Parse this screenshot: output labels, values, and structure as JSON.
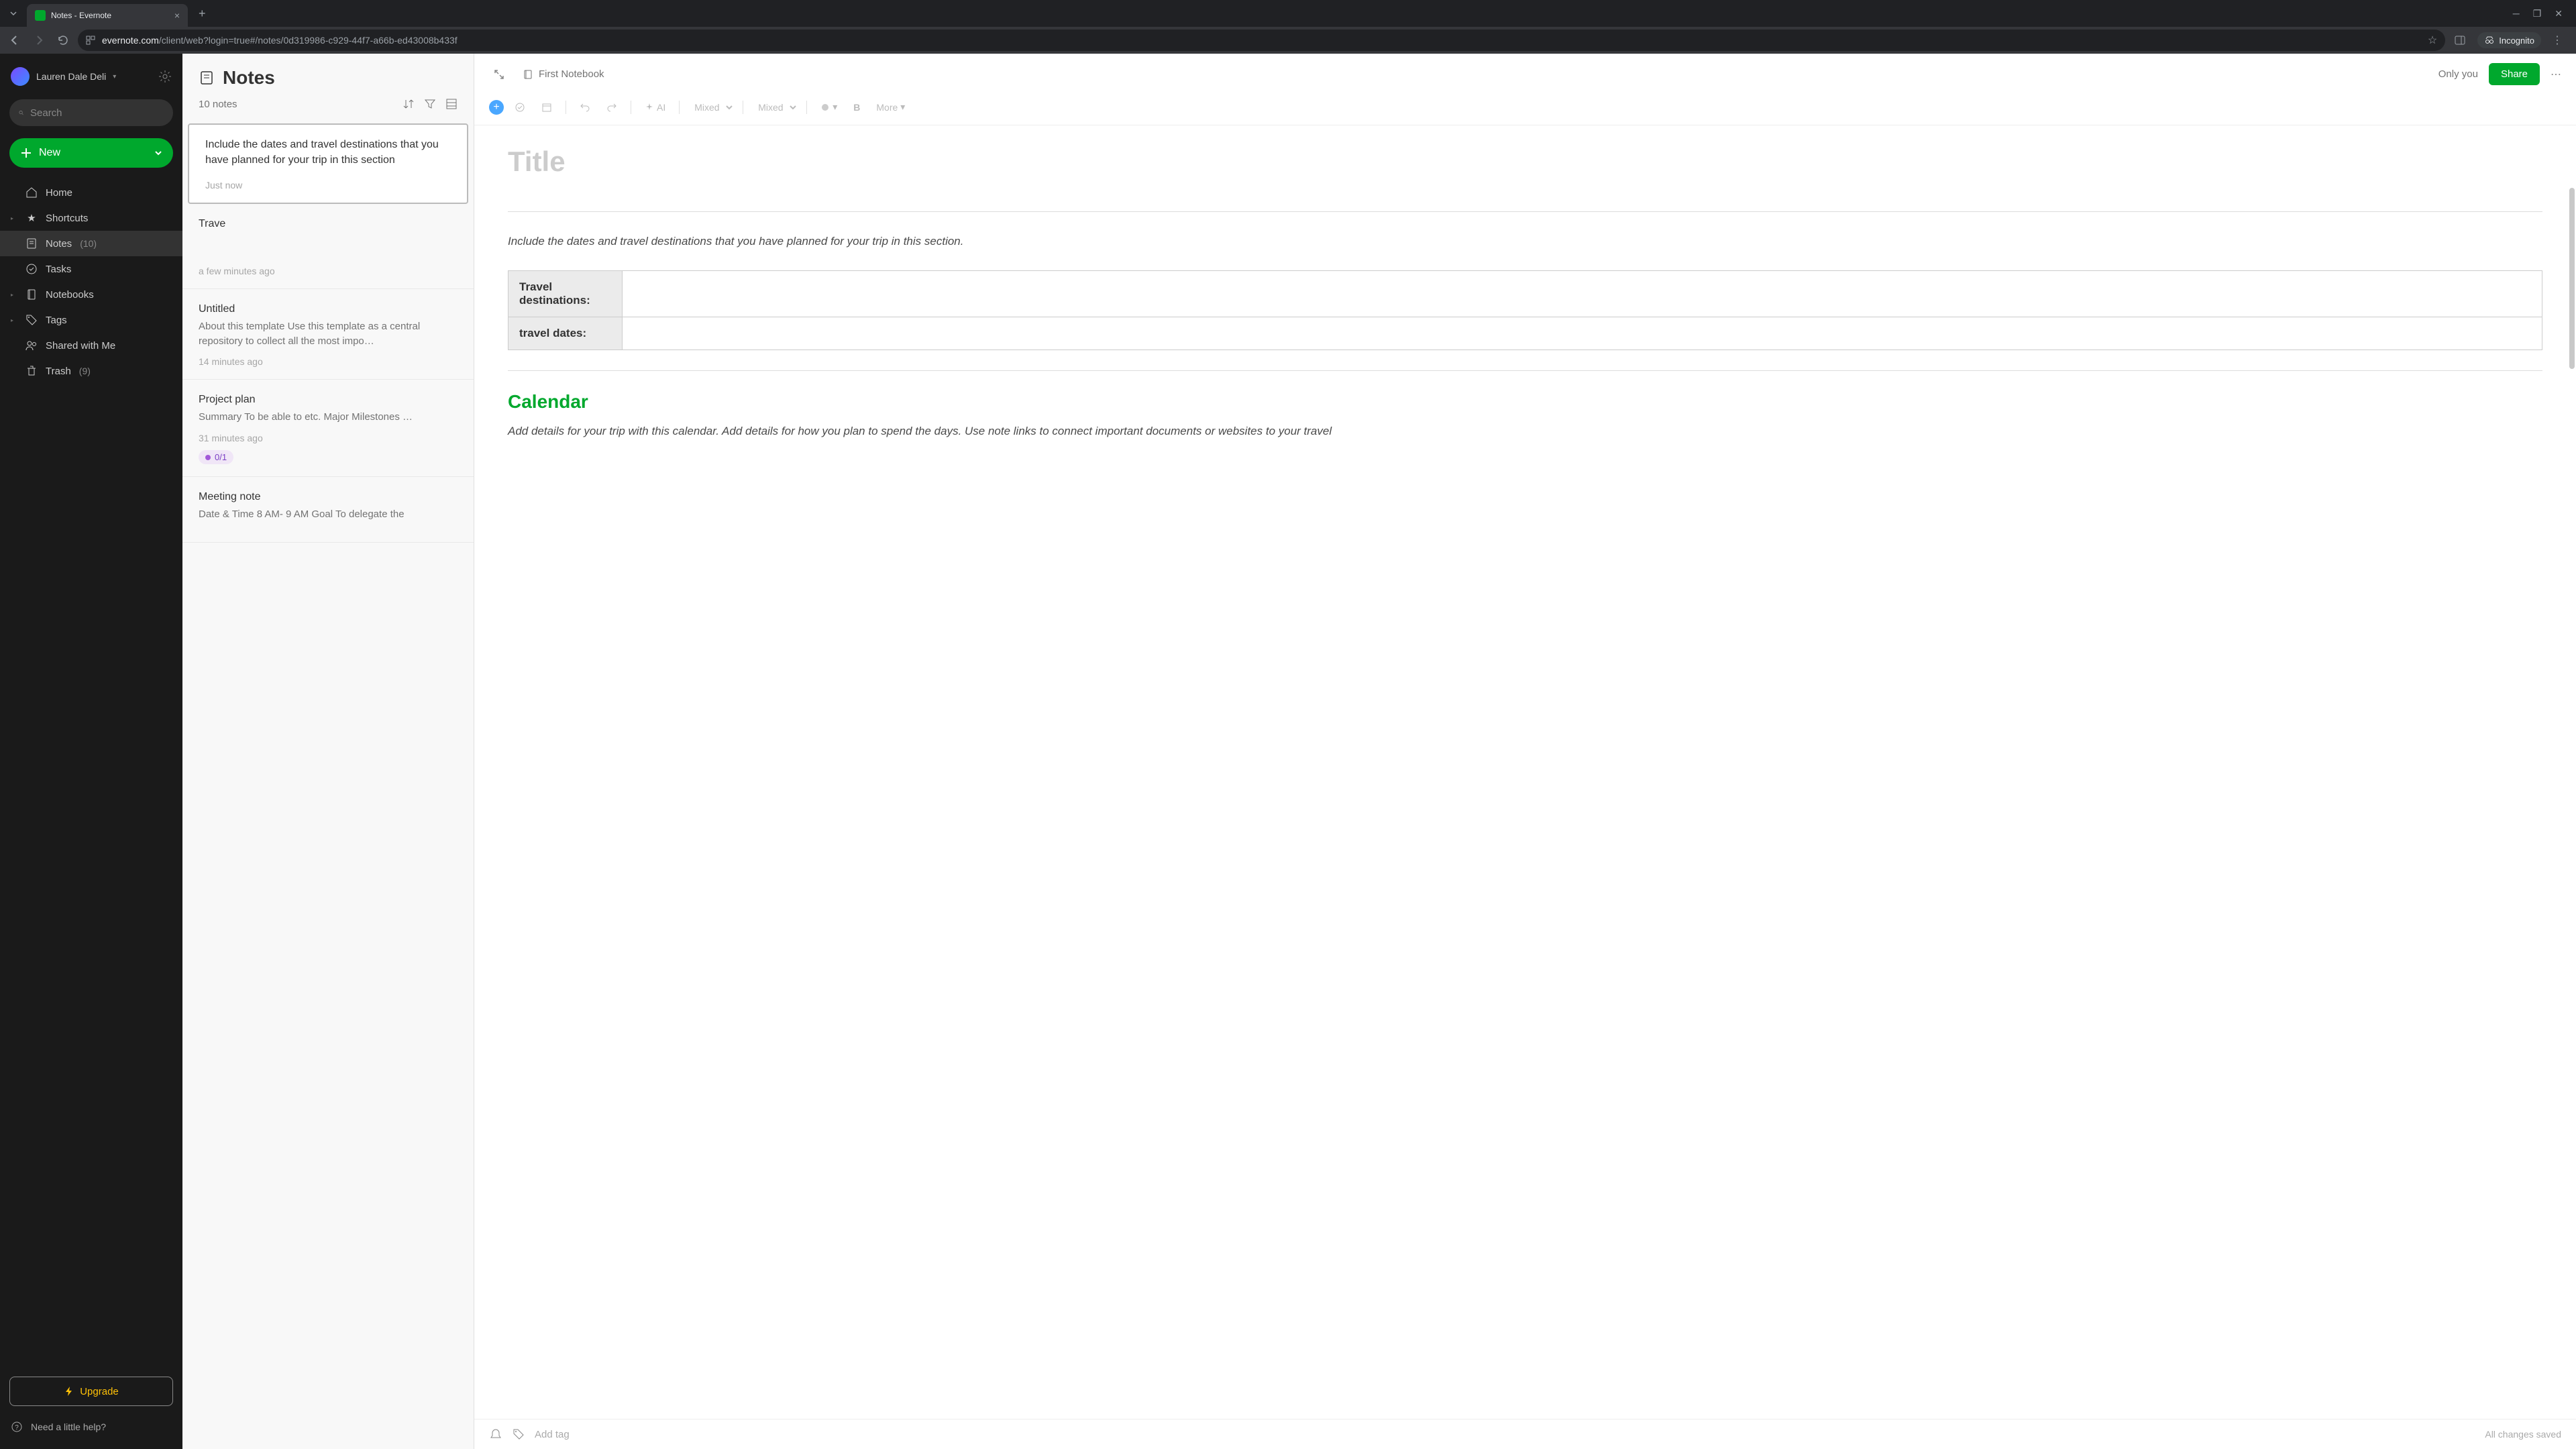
{
  "browser": {
    "tab_title": "Notes - Evernote",
    "url_domain": "evernote.com",
    "url_path": "/client/web?login=true#/notes/0d319986-c929-44f7-a66b-ed43008b433f",
    "incognito_label": "Incognito"
  },
  "sidebar": {
    "user_name": "Lauren Dale Deli",
    "search_placeholder": "Search",
    "new_label": "New",
    "items": [
      {
        "label": "Home",
        "icon": "home"
      },
      {
        "label": "Shortcuts",
        "icon": "star",
        "expandable": true
      },
      {
        "label": "Notes",
        "icon": "note",
        "count": "(10)",
        "active": true
      },
      {
        "label": "Tasks",
        "icon": "check"
      },
      {
        "label": "Notebooks",
        "icon": "book",
        "expandable": true
      },
      {
        "label": "Tags",
        "icon": "tag",
        "expandable": true
      },
      {
        "label": "Shared with Me",
        "icon": "people"
      },
      {
        "label": "Trash",
        "icon": "trash",
        "count": "(9)"
      }
    ],
    "upgrade_label": "Upgrade",
    "help_label": "Need a little help?"
  },
  "notes_list": {
    "header": "Notes",
    "count": "10 notes",
    "cards": [
      {
        "title": "Include the dates and travel destinations that you have planned for your trip in this section",
        "preview": "",
        "time": "Just now",
        "selected": true
      },
      {
        "title": "Trave",
        "preview": "",
        "time": "a few minutes ago"
      },
      {
        "title": "Untitled",
        "preview": "About this template Use this template as a central repository to collect all the most impo…",
        "time": "14 minutes ago"
      },
      {
        "title": "Project plan",
        "preview": "Summary To be able to etc. Major Milestones …",
        "time": "31 minutes ago",
        "badge": "0/1"
      },
      {
        "title": "Meeting note",
        "preview": "Date & Time 8 AM- 9 AM Goal To delegate the",
        "time": ""
      }
    ]
  },
  "editor": {
    "notebook": "First Notebook",
    "share_status": "Only you",
    "share_button": "Share",
    "toolbar": {
      "ai_label": "AI",
      "font_family": "Mixed",
      "font_size": "Mixed",
      "more_label": "More"
    },
    "title_placeholder": "Title",
    "intro": "Include the dates and travel destinations that you have planned for your trip in this section.",
    "table": {
      "row1_label": "Travel destinations:",
      "row1_value": "",
      "row2_label": "travel dates:",
      "row2_value": ""
    },
    "calendar_heading": "Calendar",
    "calendar_text": "Add details for your trip with this calendar. Add details for how you plan to spend the days. Use note links to connect important documents or websites to your travel",
    "add_tag_placeholder": "Add tag",
    "save_status": "All changes saved"
  }
}
